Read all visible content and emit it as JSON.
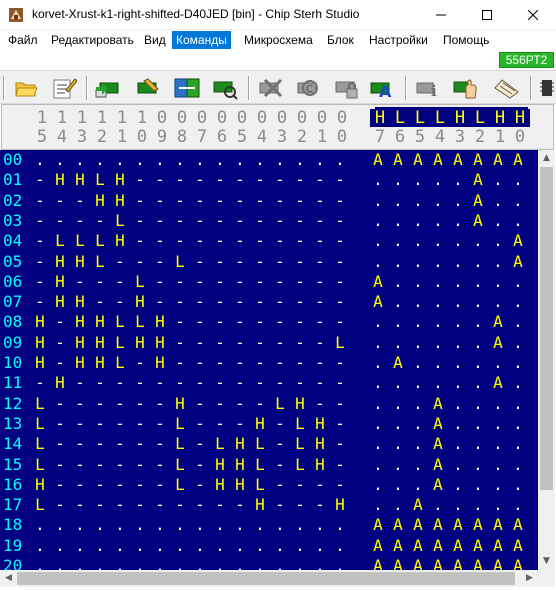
{
  "window": {
    "title": "korvet-Xrust-k1-right-shifted-D40JED [bin] - Chip Sterh Studio"
  },
  "menu": {
    "items": [
      "Файл",
      "Редактировать",
      "Вид",
      "Команды",
      "Микросхема",
      "Блок",
      "Настройки",
      "Помощь"
    ],
    "active_index": 3
  },
  "chip_badge": "556РТ2",
  "toolbar": {
    "buttons": [
      {
        "name": "open-folder-icon"
      },
      {
        "name": "edit-doc-icon"
      },
      {
        "name": "read-chip-icon"
      },
      {
        "name": "write-chip-icon"
      },
      {
        "name": "compare-icon"
      },
      {
        "name": "verify-icon"
      },
      {
        "name": "erase-icon"
      },
      {
        "name": "blank-check-icon"
      },
      {
        "name": "protect-icon"
      },
      {
        "name": "auto-icon"
      },
      {
        "name": "info-icon"
      },
      {
        "name": "hand-icon"
      },
      {
        "name": "settings-icon"
      }
    ]
  },
  "header": {
    "address_top": [
      "1",
      "1",
      "1",
      "1",
      "1",
      "1",
      "0",
      "0",
      "0",
      "0",
      "0",
      "0",
      "0",
      "0",
      "0",
      "0"
    ],
    "address_bottom": [
      "5",
      "4",
      "3",
      "2",
      "1",
      "0",
      "9",
      "8",
      "7",
      "6",
      "5",
      "4",
      "3",
      "2",
      "1",
      "0"
    ],
    "data_top": [
      "H",
      "L",
      "L",
      "L",
      "H",
      "L",
      "H",
      "H"
    ],
    "data_bottom": [
      "7",
      "6",
      "5",
      "4",
      "3",
      "2",
      "1",
      "0"
    ]
  },
  "rows": [
    {
      "num": "00",
      "addr": ". . . . . . . . . . . . . . . .",
      "data": "A A A A A A A A"
    },
    {
      "num": "01",
      "addr": "- H H L H - - - - - - - - - - -",
      "data": ". . . . . A . ."
    },
    {
      "num": "02",
      "addr": "- - - H H - - - - - - - - - - -",
      "data": ". . . . . A . ."
    },
    {
      "num": "03",
      "addr": "- - - - L - - - - - - - - - - -",
      "data": ". . . . . A . ."
    },
    {
      "num": "04",
      "addr": "- L L L H - - - - - - - - - - -",
      "data": ". . . . . . . A"
    },
    {
      "num": "05",
      "addr": "- H H L - - - L - - - - - - - -",
      "data": ". . . . . . . A"
    },
    {
      "num": "06",
      "addr": "- H - - - L - - - - - - - - - -",
      "data": "A . . . . . . ."
    },
    {
      "num": "07",
      "addr": "- H H - - H - - - - - - - - - -",
      "data": "A . . . . . . ."
    },
    {
      "num": "08",
      "addr": "H - H H L L H - - - - - - - - -",
      "data": ". . . . . . A ."
    },
    {
      "num": "09",
      "addr": "H - H H L H H - - - - - - - - L",
      "data": ". . . . . . A ."
    },
    {
      "num": "10",
      "addr": "H - H H L - H - - - - - - - - -",
      "data": ". A . . . . . ."
    },
    {
      "num": "11",
      "addr": "- H - - - - - - - - - - - - - -",
      "data": ". . . . . . A ."
    },
    {
      "num": "12",
      "addr": "L - - - - - - H - - - - L H - -",
      "data": ". . . A . . . ."
    },
    {
      "num": "13",
      "addr": "L - - - - - - L - - - H - L H -",
      "data": ". . . A . . . ."
    },
    {
      "num": "14",
      "addr": "L - - - - - - L - L H L - L H -",
      "data": ". . . A . . . ."
    },
    {
      "num": "15",
      "addr": "L - - - - - - L - H H L - L H -",
      "data": ". . . A . . . ."
    },
    {
      "num": "16",
      "addr": "H - - - - - - L - H H L - - - -",
      "data": ". . . A . . . ."
    },
    {
      "num": "17",
      "addr": "L - - - - - - - - - - H - - - H",
      "data": ". . A . . . . ."
    },
    {
      "num": "18",
      "addr": ". . . . . . . . . . . . . . . .",
      "data": "A A A A A A A A"
    },
    {
      "num": "19",
      "addr": ". . . . . . . . . . . . . . . .",
      "data": "A A A A A A A A"
    },
    {
      "num": "20",
      "addr": ". . . . . . . . . . . . . . . .",
      "data": "A A A A A A A A"
    }
  ]
}
